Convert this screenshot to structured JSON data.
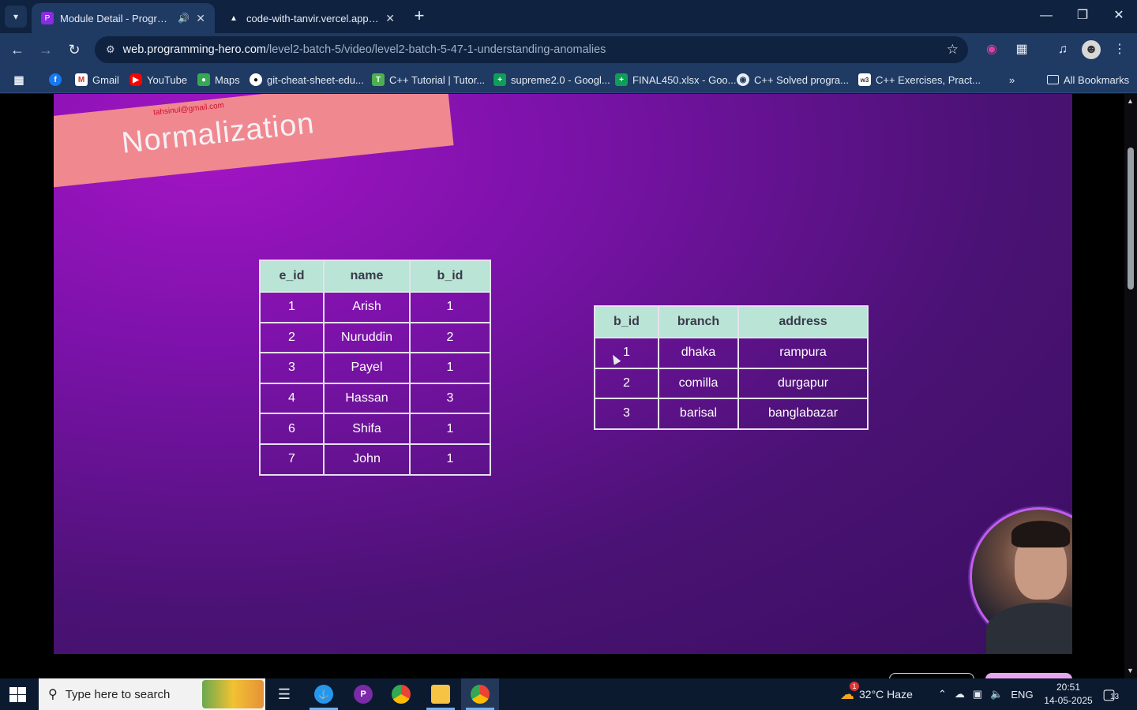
{
  "browser": {
    "tabs": [
      {
        "title": "Module Detail - Programmi",
        "active": true
      },
      {
        "title": "code-with-tanvir.vercel.app/blo",
        "active": false
      }
    ],
    "address": {
      "host": "web.programming-hero.com",
      "path": "/level2-batch-5/video/level2-batch-5-47-1-understanding-anomalies"
    },
    "bookmarks": [
      {
        "label": "Gmail",
        "icon": "gmail-icon"
      },
      {
        "label": "YouTube",
        "icon": "youtube-icon"
      },
      {
        "label": "Maps",
        "icon": "maps-icon"
      },
      {
        "label": "git-cheat-sheet-edu...",
        "icon": "github-icon"
      },
      {
        "label": "C++ Tutorial | Tutor...",
        "icon": "tutorial-icon"
      },
      {
        "label": "supreme2.0 - Googl...",
        "icon": "sheets-icon"
      },
      {
        "label": "FINAL450.xlsx - Goo...",
        "icon": "sheets-icon"
      },
      {
        "label": "C++ Solved progra...",
        "icon": "globe-icon"
      },
      {
        "label": "C++ Exercises, Pract...",
        "icon": "w3-icon"
      }
    ],
    "all_bookmarks": "All Bookmarks"
  },
  "slide": {
    "title": "Normalization",
    "email": "tahsinul@gmail.com",
    "employee_table": {
      "headers": [
        "e_id",
        "name",
        "b_id"
      ],
      "rows": [
        [
          "1",
          "Arish",
          "1"
        ],
        [
          "2",
          "Nuruddin",
          "2"
        ],
        [
          "3",
          "Payel",
          "1"
        ],
        [
          "4",
          "Hassan",
          "3"
        ],
        [
          "6",
          "Shifa",
          "1"
        ],
        [
          "7",
          "John",
          "1"
        ]
      ]
    },
    "branch_table": {
      "headers": [
        "b_id",
        "branch",
        "address"
      ],
      "rows": [
        [
          "1",
          "dhaka",
          "rampura"
        ],
        [
          "2",
          "comilla",
          "durgapur"
        ],
        [
          "3",
          "barisal",
          "banglabazar"
        ]
      ]
    }
  },
  "taskbar": {
    "search_placeholder": "Type here to search",
    "weather": "32°C  Haze",
    "weather_badge": "1",
    "language": "ENG",
    "time": "20:51",
    "date": "14-05-2025",
    "notifications": "13"
  }
}
